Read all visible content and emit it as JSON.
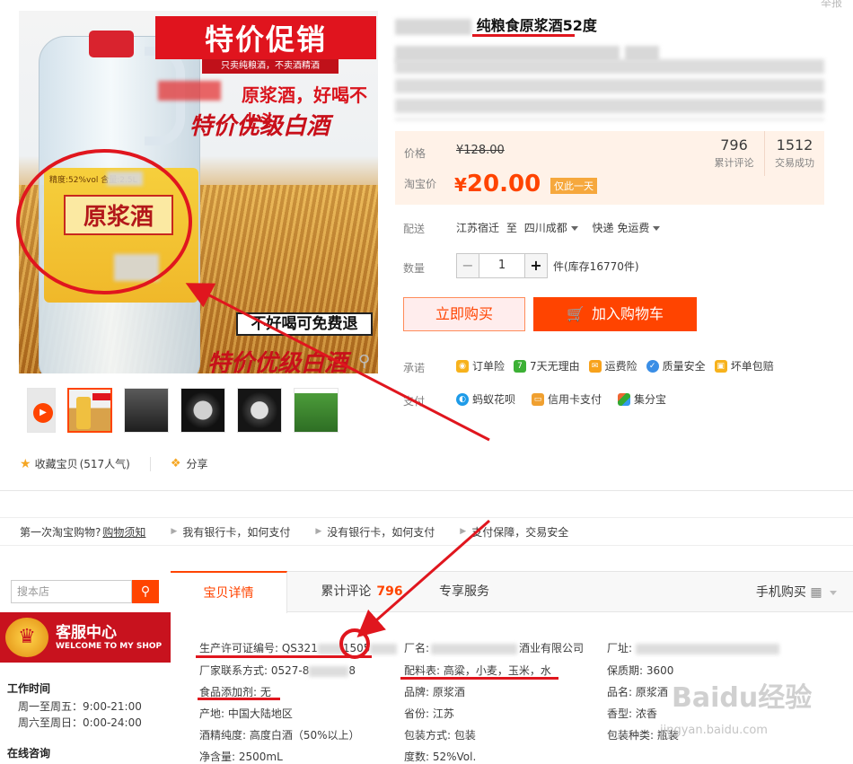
{
  "top_right_text": "举报",
  "image_ad": {
    "banner": "特价促销",
    "banner_sub": "只卖纯粮酒，不卖酒精酒",
    "line1": "原浆酒，好喝不上头",
    "line2": "特价优级白酒",
    "bottle_label": "原浆酒",
    "bottle_spec": "精度:52%vol    含量:2.5L",
    "guarantee": "不好喝可免费退",
    "bottom_slogan": "特价优级白酒"
  },
  "title": {
    "highlight": "纯粮食原浆酒52度"
  },
  "price": {
    "price_label": "价格",
    "old_price": "¥128.00",
    "taobao_label": "淘宝价",
    "yen": "¥",
    "new_price": "20.00",
    "badge": "仅此一天",
    "review_count": "796",
    "review_label": "累计评论",
    "sales_count": "1512",
    "sales_label": "交易成功"
  },
  "shipping": {
    "label": "配送",
    "from": "江苏宿迁",
    "to_word": "至",
    "to": "四川成都",
    "method": "快递 免运费"
  },
  "quantity": {
    "label": "数量",
    "value": "1",
    "minus": "−",
    "plus": "+",
    "stock": "件(库存16770件)"
  },
  "buttons": {
    "buy_now": "立即购买",
    "add_cart": "加入购物车"
  },
  "promise": {
    "label": "承诺",
    "items": [
      "订单险",
      "7天无理由",
      "运费险",
      "质量安全",
      "坏单包赔"
    ],
    "icons": [
      "7"
    ]
  },
  "payment": {
    "label": "支付",
    "items": [
      "蚂蚁花呗",
      "信用卡支付",
      "集分宝"
    ]
  },
  "favorite": {
    "label": "收藏宝贝",
    "popularity": "(517人气)",
    "share": "分享"
  },
  "tips": {
    "t1_text": "第一次淘宝购物?",
    "t1_link": "购物须知",
    "t2": "我有银行卡，如何支付",
    "t3": "没有银行卡，如何支付",
    "t4": "支付保障，交易安全"
  },
  "sidebar": {
    "search_placeholder": "搜本店",
    "kefu_title": "客服中心",
    "kefu_sub": "WELCOME TO MY SHOP",
    "work_title": "工作时间",
    "work_line1": "周一至周五：9:00-21:00",
    "work_line2": "周六至周日：0:00-24:00",
    "online_title": "在线咨询"
  },
  "tabs": {
    "detail": "宝贝详情",
    "reviews": "累计评论",
    "reviews_count": "796",
    "service": "专享服务",
    "mobile_buy": "手机购买"
  },
  "attributes": {
    "license": "生产许可证编号: QS321",
    "license_tail": "1505",
    "factory_contact": "厂家联系方式: 0527-8",
    "factory_contact_tail": "8",
    "additive": "食品添加剂: 无",
    "origin": "产地: 中国大陆地区",
    "purity": "酒精纯度: 高度白酒（50%以上）",
    "net": "净含量: 2500mL",
    "factory_name_label": "厂名:",
    "factory_name_tail": "酒业有限公司",
    "ingredients": "配料表: 高粱，小麦，玉米，水",
    "brand": "品牌: 原浆酒",
    "province": "省份: 江苏",
    "packaging": "包装方式: 包装",
    "abv": "度数: 52%Vol.",
    "factory_addr": "厂址:",
    "shelf_life": "保质期: 3600",
    "product_name": "品名: 原浆酒",
    "aroma": "香型: 浓香",
    "pack_type": "包装种类: 瓶装"
  },
  "watermark": {
    "main": "Baidu经验",
    "sub": "jingyan.baidu.com"
  },
  "colors": {
    "accent": "#ff4400",
    "annotation": "#e0161e",
    "price_bg": "#fff2e8"
  }
}
